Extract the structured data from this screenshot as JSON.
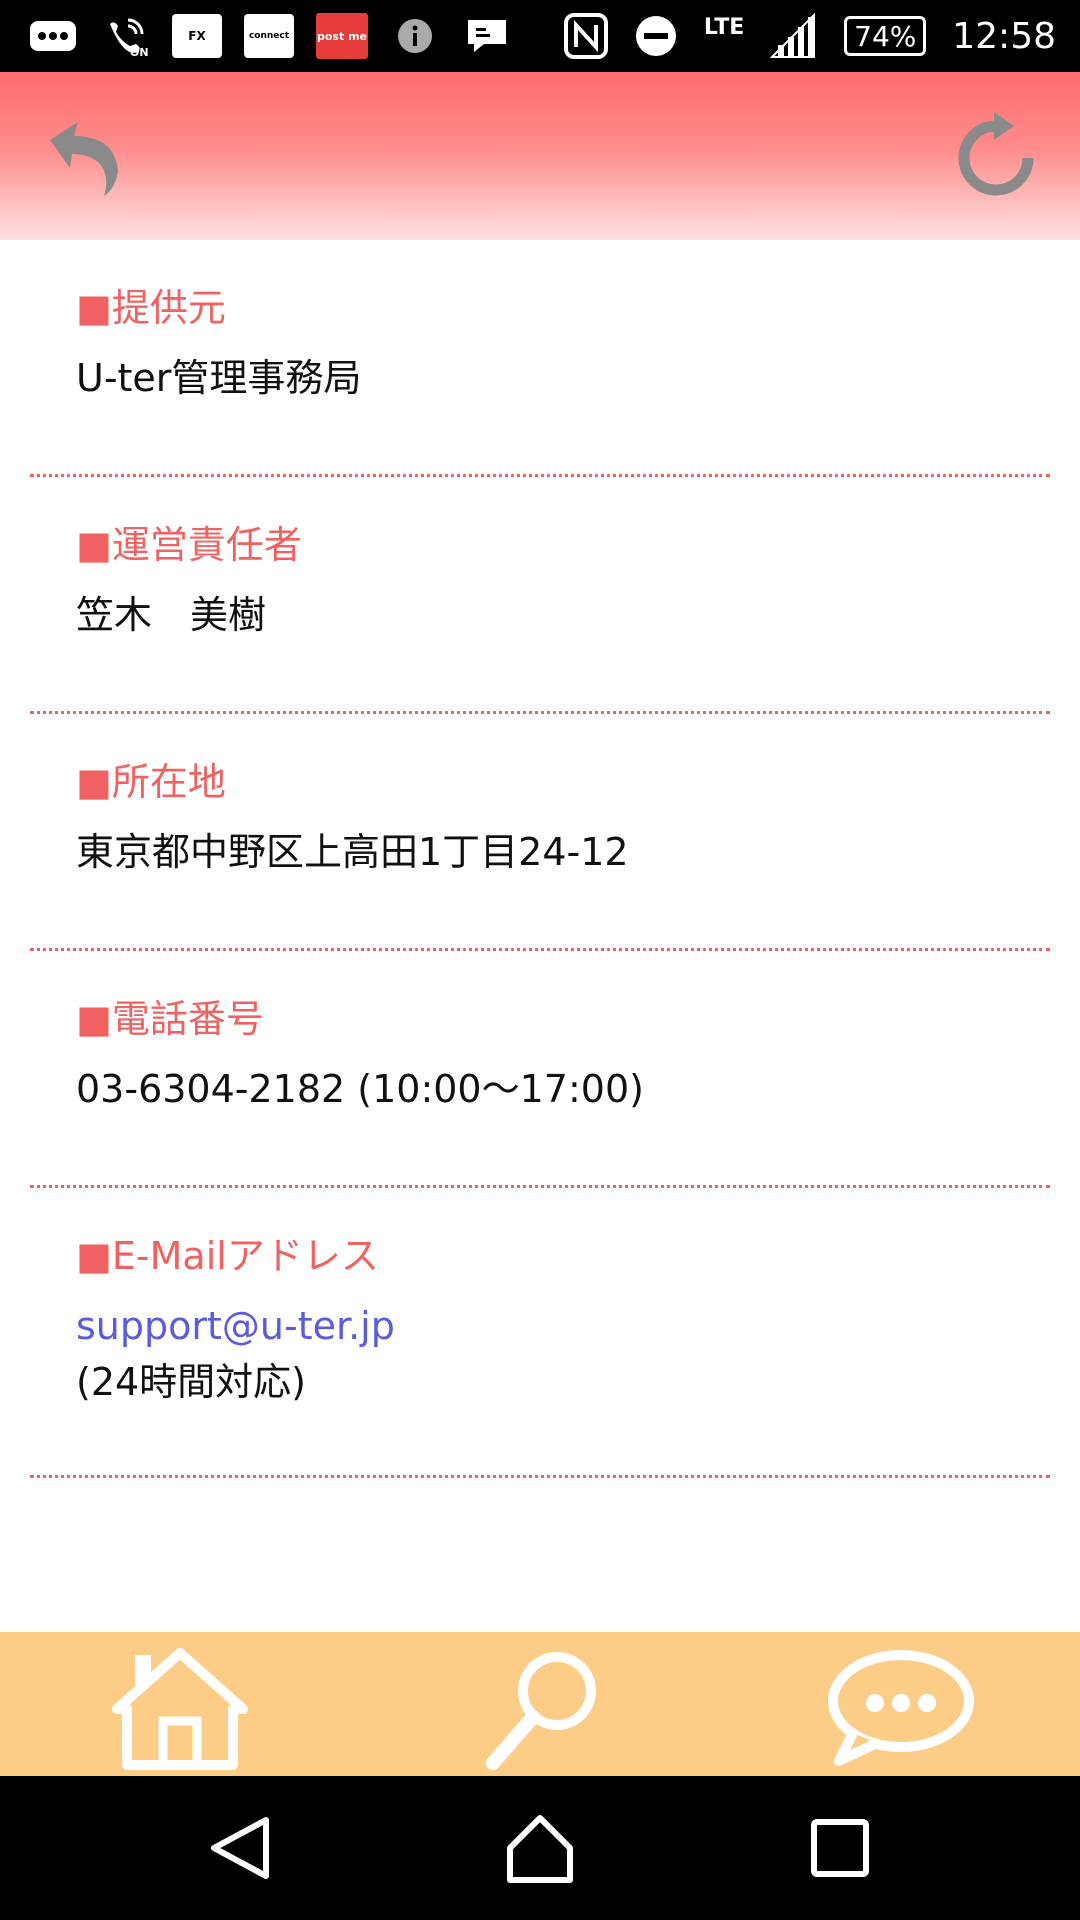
{
  "statusbar": {
    "notif_icons": [
      "more-icon",
      "wifi-calling-icon",
      "fx-icon",
      "connect-icon",
      "postme-icon",
      "info-icon",
      "message-icon"
    ],
    "fx_label": "FX",
    "connect_label": "connect",
    "postme_label": "post me",
    "network": "LTE",
    "battery": "74%",
    "time": "12:58"
  },
  "header": {
    "back_icon": "back-arrow-icon",
    "reload_icon": "reload-icon",
    "color_top": "#ff6d6d",
    "color_bottom": "#fde0e0"
  },
  "sections": [
    {
      "title": "■提供元",
      "value": "U-ter管理事務局"
    },
    {
      "title": "■運営責任者",
      "value": "笠木　美樹"
    },
    {
      "title": "■所在地",
      "value": "東京都中野区上高田1丁目24-12"
    },
    {
      "title": "■電話番号",
      "value": "03-6304-2182 (10:00〜17:00)"
    },
    {
      "title": "■E-Mailアドレス",
      "link": "support@u-ter.jp",
      "note": "(24時間対応)"
    }
  ],
  "tabbar": {
    "items": [
      "home-icon",
      "search-icon",
      "chat-icon"
    ],
    "background": "#fdcd88"
  },
  "navbar": {
    "items": [
      "nav-back-icon",
      "nav-home-icon",
      "nav-recent-icon"
    ]
  },
  "colors": {
    "accent": "#f06262",
    "link": "#5b5bdf"
  }
}
